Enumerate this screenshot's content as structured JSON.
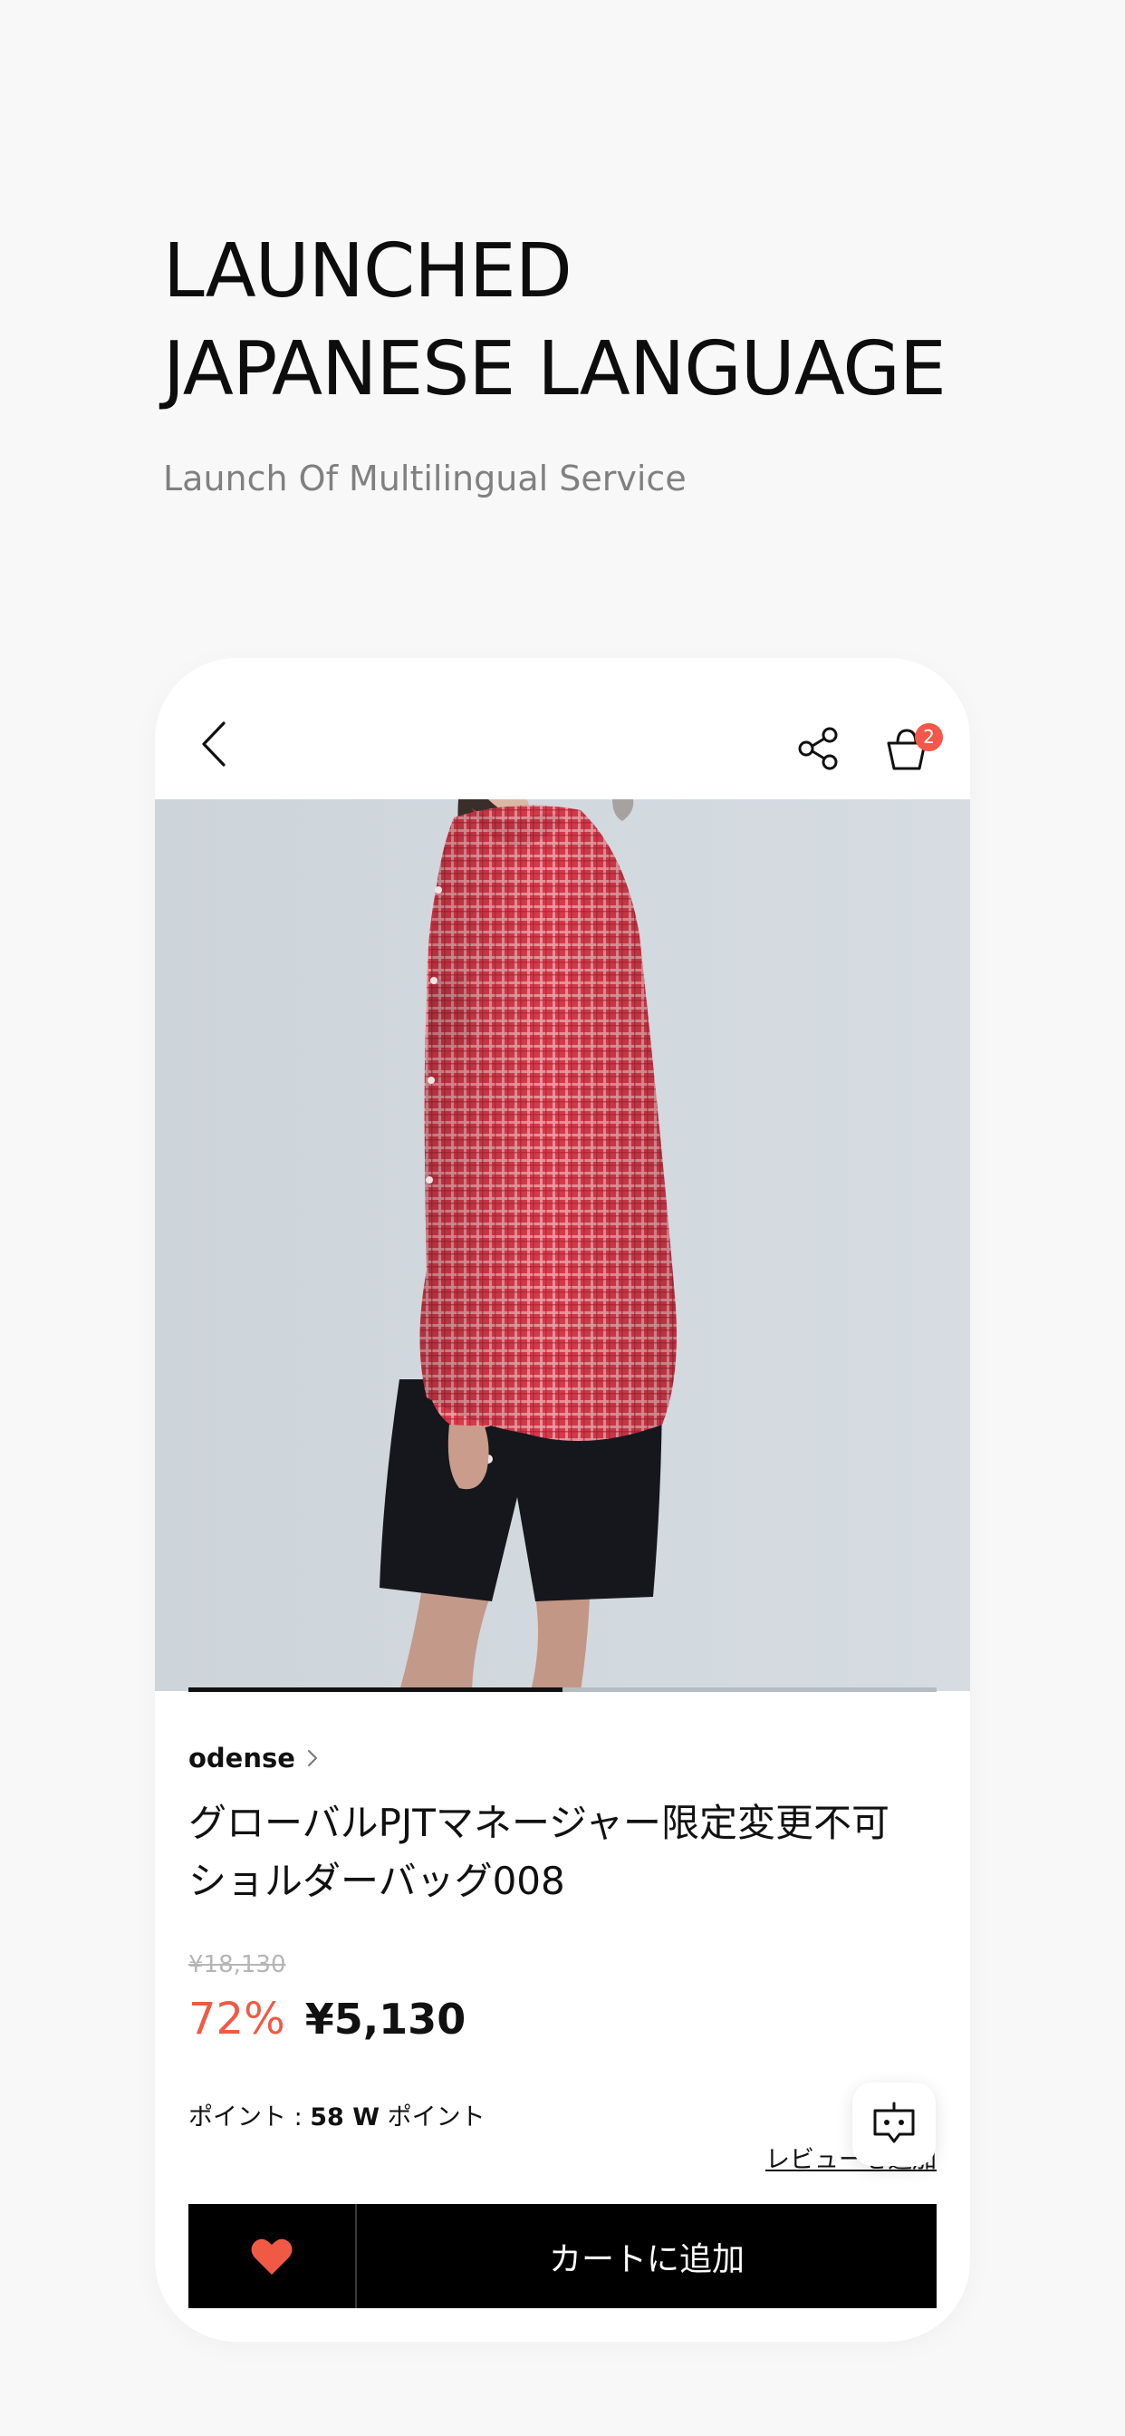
{
  "hero": {
    "title_line1": "LAUNCHED",
    "title_line2": "JAPANESE LANGUAGE",
    "subtitle": "Launch Of Multilingual Service"
  },
  "header": {
    "back_icon": "chevron-left-icon",
    "share_icon": "share-icon",
    "cart_icon": "shopping-bag-icon",
    "cart_count": "2",
    "badge_color": "#f2574a"
  },
  "gallery": {
    "progress": 0.5
  },
  "product": {
    "brand": "odense",
    "title_line1": "グローバルPJTマネージャー限定変更不可",
    "title_line2": "ショルダーバッグ008",
    "original_price": "¥18,130",
    "discount_rate": "72%",
    "sale_price": "¥5,130",
    "points_label": "ポイント : ",
    "points_value": "58 W",
    "points_suffix": " ポイント",
    "review_link": "レビューを追加",
    "accent_color": "#f05a45"
  },
  "actions": {
    "wishlist_icon": "heart-icon",
    "add_to_cart_label": "カートに追加",
    "chatbot_icon": "chatbot-icon"
  }
}
